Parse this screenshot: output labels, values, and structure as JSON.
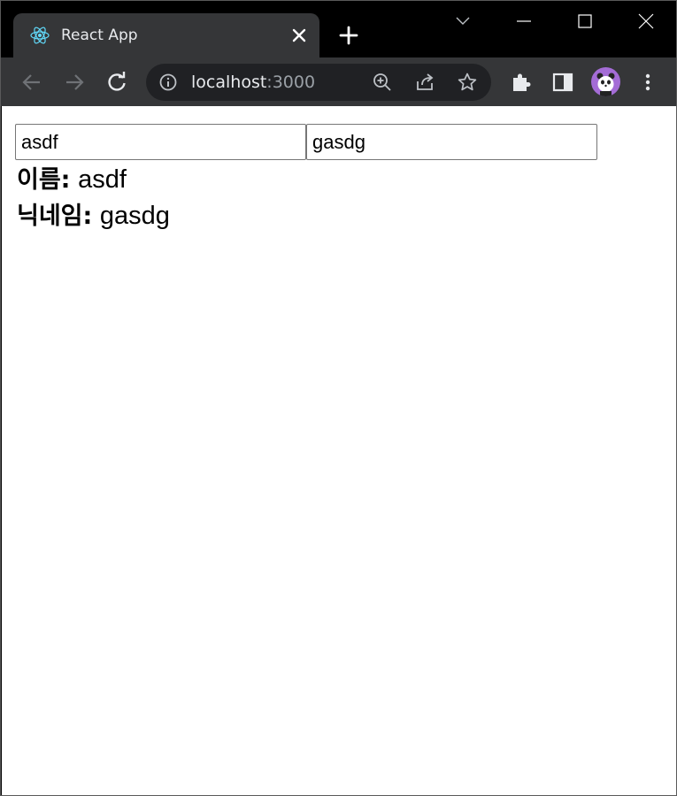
{
  "browser": {
    "tab_title": "React App",
    "url_host": "localhost",
    "url_rest": ":3000",
    "colors": {
      "frame": "#000000",
      "toolbar": "#353638",
      "omnibox": "#202124",
      "avatar": "#a46cd6"
    }
  },
  "form": {
    "name_value": "asdf",
    "nickname_value": "gasdg"
  },
  "display": {
    "name_label": "이름:",
    "name_value": "asdf",
    "nickname_label": "닉네임:",
    "nickname_value": "gasdg"
  }
}
